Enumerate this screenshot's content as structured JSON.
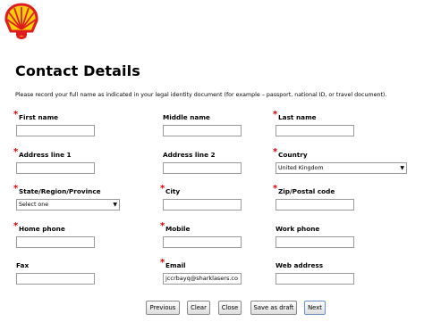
{
  "page": {
    "title": "Contact Details",
    "instructions": "Please record your full name as indicated in your legal identity document (for example – passport, national ID, or travel document)."
  },
  "fields": {
    "first_name": {
      "label": "First name",
      "value": ""
    },
    "middle_name": {
      "label": "Middle name",
      "value": ""
    },
    "last_name": {
      "label": "Last name",
      "value": ""
    },
    "address_line_1": {
      "label": "Address line 1",
      "value": ""
    },
    "address_line_2": {
      "label": "Address line 2",
      "value": ""
    },
    "country": {
      "label": "Country",
      "value": "United Kingdom"
    },
    "state": {
      "label": "State/Region/Province",
      "value": "Select one"
    },
    "city": {
      "label": "City",
      "value": ""
    },
    "zip": {
      "label": "Zip/Postal code",
      "value": ""
    },
    "home_phone": {
      "label": "Home phone",
      "value": ""
    },
    "mobile": {
      "label": "Mobile",
      "value": ""
    },
    "work_phone": {
      "label": "Work phone",
      "value": ""
    },
    "fax": {
      "label": "Fax",
      "value": ""
    },
    "email": {
      "label": "Email",
      "value": "jccrbayq@sharklasers.co"
    },
    "web_address": {
      "label": "Web address",
      "value": ""
    }
  },
  "required_marker": "*",
  "buttons": {
    "previous": "Previous",
    "clear": "Clear",
    "close": "Close",
    "save_draft": "Save as draft",
    "next": "Next"
  },
  "colors": {
    "logo_red": "#dd1d21",
    "logo_yellow": "#fbce07",
    "required": "#dd0000"
  }
}
